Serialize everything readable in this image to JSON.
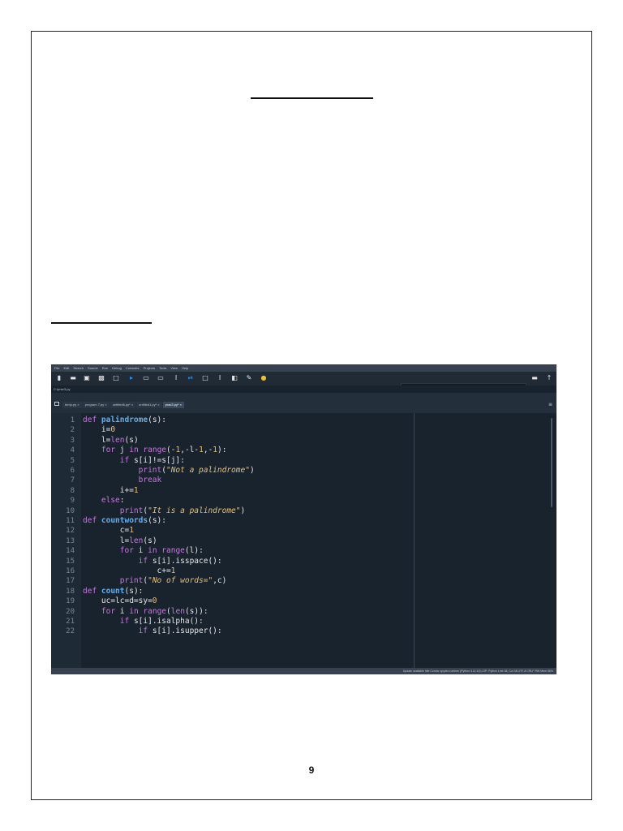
{
  "page": {
    "page_number": "9"
  },
  "ide": {
    "menu": [
      "File",
      "Edit",
      "Search",
      "Source",
      "Run",
      "Debug",
      "Consoles",
      "Projects",
      "Tools",
      "View",
      "Help"
    ],
    "path_input": "<!>",
    "file_path": "C:/prac3.py",
    "tabs": [
      {
        "label": "temp.py ×"
      },
      {
        "label": "program 7.py ×"
      },
      {
        "label": "untitled6.py* ×"
      },
      {
        "label": "untitled1.py* ×"
      },
      {
        "label": "prac3.py* ×"
      }
    ],
    "status": "Update available   Idle   Conda: spyder-runtime (Python 3.11.10)   LSP: Python   Line 38, Col 38   UTF-8   CRLF   RW   Mem 56%"
  },
  "code_lines": [
    {
      "n": "1",
      "tokens": [
        {
          "t": "def ",
          "c": "kw"
        },
        {
          "t": "palindrome",
          "c": "fn"
        },
        {
          "t": "(s):",
          "c": ""
        }
      ]
    },
    {
      "n": "2",
      "tokens": [
        {
          "t": "    i=",
          "c": ""
        },
        {
          "t": "0",
          "c": "num"
        }
      ]
    },
    {
      "n": "3",
      "tokens": [
        {
          "t": "    l=",
          "c": ""
        },
        {
          "t": "len",
          "c": "bi"
        },
        {
          "t": "(s)",
          "c": ""
        }
      ]
    },
    {
      "n": "4",
      "tokens": [
        {
          "t": "    ",
          "c": ""
        },
        {
          "t": "for",
          "c": "kw"
        },
        {
          "t": " j ",
          "c": ""
        },
        {
          "t": "in",
          "c": "kw"
        },
        {
          "t": " ",
          "c": ""
        },
        {
          "t": "range",
          "c": "bi"
        },
        {
          "t": "(-",
          "c": ""
        },
        {
          "t": "1",
          "c": "num"
        },
        {
          "t": ",-l-",
          "c": ""
        },
        {
          "t": "1",
          "c": "num"
        },
        {
          "t": ",-",
          "c": ""
        },
        {
          "t": "1",
          "c": "num"
        },
        {
          "t": "):",
          "c": ""
        }
      ]
    },
    {
      "n": "5",
      "tokens": [
        {
          "t": "        ",
          "c": ""
        },
        {
          "t": "if",
          "c": "kw"
        },
        {
          "t": " s[i]!=s[j]:",
          "c": ""
        }
      ]
    },
    {
      "n": "6",
      "tokens": [
        {
          "t": "            ",
          "c": ""
        },
        {
          "t": "print",
          "c": "bi"
        },
        {
          "t": "(",
          "c": ""
        },
        {
          "t": "\"Not a palindrome\"",
          "c": "str"
        },
        {
          "t": ")",
          "c": ""
        }
      ]
    },
    {
      "n": "7",
      "tokens": [
        {
          "t": "            ",
          "c": ""
        },
        {
          "t": "break",
          "c": "kw"
        }
      ]
    },
    {
      "n": "8",
      "tokens": [
        {
          "t": "        i+=",
          "c": ""
        },
        {
          "t": "1",
          "c": "num"
        }
      ]
    },
    {
      "n": "9",
      "tokens": [
        {
          "t": "    ",
          "c": ""
        },
        {
          "t": "else",
          "c": "kw"
        },
        {
          "t": ":",
          "c": ""
        }
      ]
    },
    {
      "n": "10",
      "tokens": [
        {
          "t": "        ",
          "c": ""
        },
        {
          "t": "print",
          "c": "bi"
        },
        {
          "t": "(",
          "c": ""
        },
        {
          "t": "\"It is a palindrome\"",
          "c": "str"
        },
        {
          "t": ")",
          "c": ""
        }
      ]
    },
    {
      "n": "11",
      "tokens": [
        {
          "t": "def ",
          "c": "kw"
        },
        {
          "t": "countwords",
          "c": "fn"
        },
        {
          "t": "(s):",
          "c": ""
        }
      ]
    },
    {
      "n": "12",
      "tokens": [
        {
          "t": "        c=",
          "c": ""
        },
        {
          "t": "1",
          "c": "num"
        }
      ]
    },
    {
      "n": "13",
      "tokens": [
        {
          "t": "        l=",
          "c": ""
        },
        {
          "t": "len",
          "c": "bi"
        },
        {
          "t": "(s)",
          "c": ""
        }
      ]
    },
    {
      "n": "14",
      "tokens": [
        {
          "t": "        ",
          "c": ""
        },
        {
          "t": "for",
          "c": "kw"
        },
        {
          "t": " i ",
          "c": ""
        },
        {
          "t": "in",
          "c": "kw"
        },
        {
          "t": " ",
          "c": ""
        },
        {
          "t": "range",
          "c": "bi"
        },
        {
          "t": "(l):",
          "c": ""
        }
      ]
    },
    {
      "n": "15",
      "tokens": [
        {
          "t": "            ",
          "c": ""
        },
        {
          "t": "if",
          "c": "kw"
        },
        {
          "t": " s[i].isspace():",
          "c": ""
        }
      ]
    },
    {
      "n": "16",
      "tokens": [
        {
          "t": "                c+=",
          "c": ""
        },
        {
          "t": "1",
          "c": "num"
        }
      ]
    },
    {
      "n": "17",
      "tokens": [
        {
          "t": "        ",
          "c": ""
        },
        {
          "t": "print",
          "c": "bi"
        },
        {
          "t": "(",
          "c": ""
        },
        {
          "t": "\"No of words=\"",
          "c": "str"
        },
        {
          "t": ",c)",
          "c": ""
        }
      ]
    },
    {
      "n": "18",
      "tokens": [
        {
          "t": "def ",
          "c": "kw"
        },
        {
          "t": "count",
          "c": "fn"
        },
        {
          "t": "(s):",
          "c": ""
        }
      ]
    },
    {
      "n": "19",
      "tokens": [
        {
          "t": "    uc=lc=d=sy=",
          "c": ""
        },
        {
          "t": "0",
          "c": "num"
        }
      ]
    },
    {
      "n": "20",
      "tokens": [
        {
          "t": "    ",
          "c": ""
        },
        {
          "t": "for",
          "c": "kw"
        },
        {
          "t": " i ",
          "c": ""
        },
        {
          "t": "in",
          "c": "kw"
        },
        {
          "t": " ",
          "c": ""
        },
        {
          "t": "range",
          "c": "bi"
        },
        {
          "t": "(",
          "c": ""
        },
        {
          "t": "len",
          "c": "bi"
        },
        {
          "t": "(s)):",
          "c": ""
        }
      ]
    },
    {
      "n": "21",
      "tokens": [
        {
          "t": "        ",
          "c": ""
        },
        {
          "t": "if",
          "c": "kw"
        },
        {
          "t": " s[i].isalpha():",
          "c": ""
        }
      ]
    },
    {
      "n": "22",
      "tokens": [
        {
          "t": "            ",
          "c": ""
        },
        {
          "t": "if",
          "c": "kw"
        },
        {
          "t": " s[i].isupper():",
          "c": ""
        }
      ]
    }
  ],
  "toolbar_icons": [
    "new-file-icon",
    "open-folder-icon",
    "save-icon",
    "save-all-icon",
    "new-window-icon",
    "run-icon",
    "run-cell-icon",
    "run-cell-advance-icon",
    "run-selection-icon",
    "debug-icon",
    "stop-icon",
    "step-icon",
    "maximize-icon",
    "settings-icon",
    "python-path-icon"
  ],
  "colors": {
    "accent": "#1e90ff",
    "editor_bg": "#19232d"
  }
}
